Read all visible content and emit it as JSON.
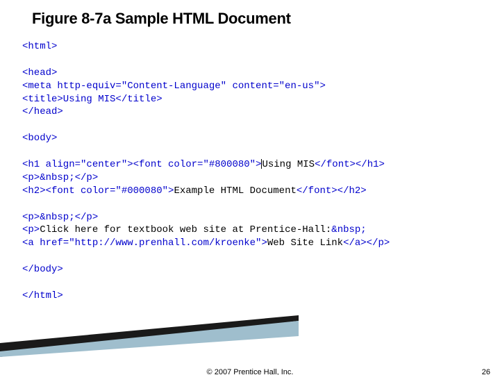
{
  "title": "Figure 8-7a Sample HTML Document",
  "code": {
    "l1": "<html>",
    "l2": "<head>",
    "l3": "<meta http-equiv=\"Content-Language\" content=\"en-us\">",
    "l4": "<title>Using MIS</title>",
    "l5": "</head>",
    "l6": "<body>",
    "l7a": "<h1 align=\"center\"><font color=\"#800080\">",
    "l7b": "Using MIS",
    "l7c": "</font></h1>",
    "l8": "<p>&nbsp;</p>",
    "l9a": "<h2><font color=\"#000080\">",
    "l9b": "Example HTML Document",
    "l9c": "</font></h2>",
    "l10": "<p>&nbsp;</p>",
    "l11a": "<p>",
    "l11b": "Click here for textbook web site at Prentice-Hall:",
    "l11c": "&nbsp;",
    "l12a": "<a href=\"http://www.prenhall.com/kroenke\">",
    "l12b": "Web Site Link",
    "l12c": "</a></p>",
    "l13": "</body>",
    "l14": "</html>"
  },
  "footer": {
    "copyright": "© 2007 Prentice Hall, Inc.",
    "page": "26"
  }
}
